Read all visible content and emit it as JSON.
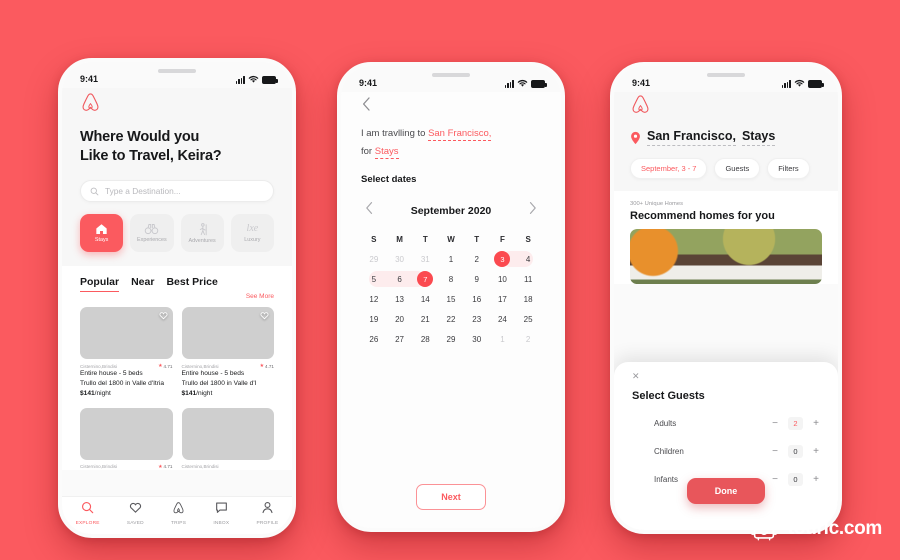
{
  "background_color": "#fb5a5f",
  "accent_color": "#fb5a5f",
  "phone1": {
    "status_bar": {
      "time": "9:41",
      "signal_icon": "signal-bars-icon",
      "wifi_icon": "wifi-icon",
      "battery_icon": "battery-icon"
    },
    "logo_icon": "airbnb-belo-logo",
    "title_line1": "Where Would you",
    "title_line2": "Like to Travel, Keira?",
    "search": {
      "placeholder": "Type a Destination...",
      "value": "",
      "icon": "search-icon"
    },
    "categories": [
      {
        "label": "Stays",
        "icon": "house-icon",
        "active": true
      },
      {
        "label": "Experiences",
        "icon": "binoculars-icon",
        "active": false
      },
      {
        "label": "Adventures",
        "icon": "hiker-icon",
        "active": false
      },
      {
        "label": "Luxury",
        "icon": "luxury-script-icon",
        "active": false
      }
    ],
    "tabs": [
      {
        "label": "Popular",
        "active": true
      },
      {
        "label": "Near",
        "active": false
      },
      {
        "label": "Best Price",
        "active": false
      }
    ],
    "see_more": "See More",
    "listings": [
      {
        "host": "Cisternino,Brindisi",
        "rating": "4.71",
        "line1": "Entire house - 5 beds",
        "line2": "Trullo del 1800 in Valle d'Itria",
        "price": "$141",
        "price_suffix": "/night",
        "photo": "ph-house1",
        "favorite_icon": "heart-icon"
      },
      {
        "host": "Cisternino,Brindisi",
        "rating": "4.71",
        "line1": "Entire house - 5 beds",
        "line2": "Trullo del 1800 in Valle d'I",
        "price": "$141",
        "price_suffix": "/night",
        "photo": "ph-stone",
        "favorite_icon": "heart-icon"
      },
      {
        "host": "Cisternino,Brindisi",
        "rating": "4.71",
        "line1": "",
        "line2": "",
        "price": "",
        "price_suffix": "",
        "photo": "ph-room",
        "favorite_icon": "heart-icon"
      },
      {
        "host": "Cisternino,Brindisi",
        "rating": "",
        "line1": "",
        "line2": "",
        "price": "",
        "price_suffix": "",
        "photo": "ph-cabin",
        "favorite_icon": "heart-icon"
      }
    ],
    "tabbar": [
      {
        "label": "EXPLORE",
        "icon": "search-icon",
        "active": true
      },
      {
        "label": "SAVED",
        "icon": "heart-icon",
        "active": false
      },
      {
        "label": "TRIPS",
        "icon": "airbnb-belo-icon",
        "active": false
      },
      {
        "label": "INBOX",
        "icon": "message-icon",
        "active": false
      },
      {
        "label": "PROFILE",
        "icon": "person-icon",
        "active": false
      }
    ]
  },
  "phone2": {
    "status_bar": {
      "time": "9:41",
      "signal_icon": "signal-bars-icon",
      "wifi_icon": "wifi-icon",
      "battery_icon": "battery-icon"
    },
    "back_icon": "chevron-left-icon",
    "sentence_part1": "I am travlling to ",
    "destination": "San Francisco,",
    "sentence_part2": "for ",
    "trip_type": "Stays",
    "select_dates_label": "Select dates",
    "calendar": {
      "month_label": "September 2020",
      "prev_icon": "chevron-left-icon",
      "next_icon": "chevron-right-icon",
      "day_headers": [
        "S",
        "M",
        "T",
        "W",
        "T",
        "F",
        "S"
      ],
      "weeks": [
        [
          {
            "n": "29",
            "mute": true
          },
          {
            "n": "30",
            "mute": true
          },
          {
            "n": "31",
            "mute": true
          },
          {
            "n": "1"
          },
          {
            "n": "2"
          },
          {
            "n": "3",
            "selected": true,
            "range_start": true
          },
          {
            "n": "4",
            "range_end_row": true
          }
        ],
        [
          {
            "n": "5",
            "range_start_row": true
          },
          {
            "n": "6",
            "in_range": true
          },
          {
            "n": "7",
            "selected": true,
            "range_end": true
          },
          {
            "n": "8"
          },
          {
            "n": "9"
          },
          {
            "n": "10"
          },
          {
            "n": "11"
          }
        ],
        [
          {
            "n": "12"
          },
          {
            "n": "13"
          },
          {
            "n": "14"
          },
          {
            "n": "15"
          },
          {
            "n": "16"
          },
          {
            "n": "17"
          },
          {
            "n": "18"
          }
        ],
        [
          {
            "n": "19"
          },
          {
            "n": "20"
          },
          {
            "n": "21"
          },
          {
            "n": "22"
          },
          {
            "n": "23"
          },
          {
            "n": "24"
          },
          {
            "n": "25"
          }
        ],
        [
          {
            "n": "26"
          },
          {
            "n": "27"
          },
          {
            "n": "28"
          },
          {
            "n": "29"
          },
          {
            "n": "30"
          },
          {
            "n": "1",
            "mute": true
          },
          {
            "n": "2",
            "mute": true
          }
        ]
      ]
    },
    "next_button": "Next"
  },
  "phone3": {
    "status_bar": {
      "time": "9:41",
      "signal_icon": "signal-bars-icon",
      "wifi_icon": "wifi-icon",
      "battery_icon": "battery-icon"
    },
    "logo_icon": "airbnb-belo-logo",
    "location_pin_icon": "map-pin-icon",
    "location": "San Francisco,",
    "trip_type": "Stays",
    "chips": [
      {
        "label": "September, 3 - 7",
        "highlight": true
      },
      {
        "label": "Guests",
        "highlight": false
      },
      {
        "label": "Filters",
        "highlight": false
      }
    ],
    "unique_homes": "300+ Unique Homes",
    "heading": "Recommend homes for you",
    "photo": "ph-autumn",
    "sheet": {
      "close_icon": "close-icon",
      "title": "Select Guests",
      "rows": [
        {
          "label": "Adults",
          "count": "2",
          "highlight": true,
          "minus": "−",
          "plus": "+"
        },
        {
          "label": "Children",
          "count": "0",
          "highlight": false,
          "minus": "−",
          "plus": "+"
        },
        {
          "label": "Infants",
          "count": "0",
          "highlight": false,
          "minus": "−",
          "plus": "+"
        }
      ],
      "done_button": "Done"
    }
  },
  "watermark": {
    "text": "touric.com",
    "icon": "suitcase-smiley-icon"
  }
}
